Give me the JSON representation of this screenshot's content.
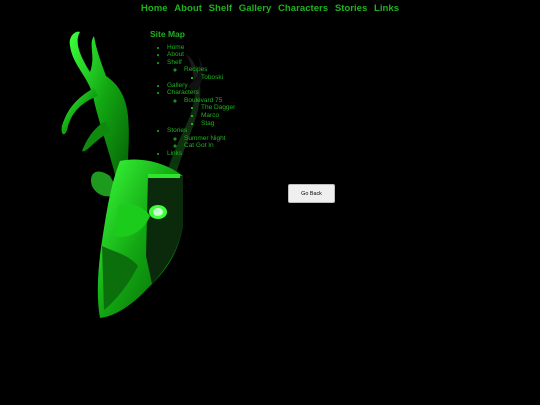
{
  "nav": {
    "items": [
      "Home",
      "About",
      "Shelf",
      "Gallery",
      "Characters",
      "Stories",
      "Links"
    ]
  },
  "sitemap": {
    "title": "Site Map",
    "home": "Home",
    "about": "About",
    "shelf": "Shelf",
    "recipes": "Recipes",
    "toboski": "Toboski",
    "gallery": "Gallery",
    "characters": "Characters",
    "boulevard": "Boulevard 75",
    "dagger": "The Dagger",
    "marco": "Marco",
    "stag": "Stag",
    "stories": "Stories",
    "summer_night": "Summer Night",
    "cat_got_in": "Cat Got In",
    "links": "Links"
  },
  "button": {
    "go_back": "Go Back"
  },
  "colors": {
    "accent": "#1fb11f",
    "glow": "#3dff3d",
    "background": "#000000"
  },
  "icons": {
    "skull": "deer-skull-icon"
  }
}
